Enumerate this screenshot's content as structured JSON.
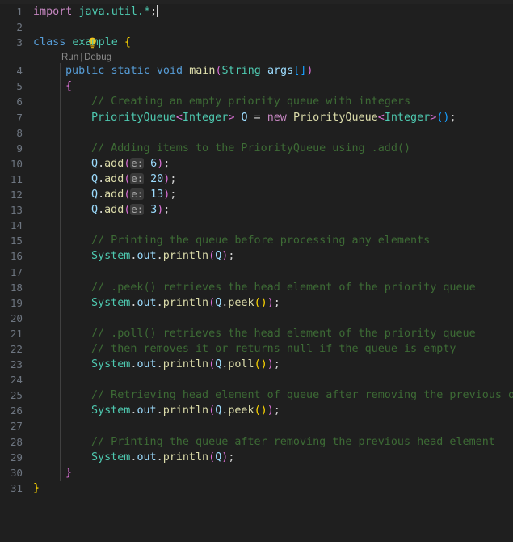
{
  "editor": {
    "language": "java",
    "theme": "dark",
    "background": "#1f1f1f",
    "gutter_color": "#6e7681",
    "comment_color": "#3d6b35",
    "total_lines": 31
  },
  "codelens": {
    "run_label": "Run",
    "separator": "|",
    "debug_label": "Debug"
  },
  "quickfix": {
    "icon": "lightbulb-icon",
    "line": 2
  },
  "lines": [
    {
      "n": "1",
      "text": "import java.util.*;"
    },
    {
      "n": "2",
      "text": ""
    },
    {
      "n": "3",
      "text": "class example {"
    },
    {
      "n": "4",
      "text": "    public static void main(String args[])"
    },
    {
      "n": "5",
      "text": "    {"
    },
    {
      "n": "6",
      "text": "        // Creating an empty priority queue with integers"
    },
    {
      "n": "7",
      "text": "        PriorityQueue<Integer> Q = new PriorityQueue<Integer>();"
    },
    {
      "n": "8",
      "text": ""
    },
    {
      "n": "9",
      "text": "        // Adding items to the PriorityQueue using .add()"
    },
    {
      "n": "10",
      "text": "        Q.add(e: 6);"
    },
    {
      "n": "11",
      "text": "        Q.add(e: 20);"
    },
    {
      "n": "12",
      "text": "        Q.add(e: 13);"
    },
    {
      "n": "13",
      "text": "        Q.add(e: 3);"
    },
    {
      "n": "14",
      "text": ""
    },
    {
      "n": "15",
      "text": "        // Printing the queue before processing any elements"
    },
    {
      "n": "16",
      "text": "        System.out.println(Q);"
    },
    {
      "n": "17",
      "text": ""
    },
    {
      "n": "18",
      "text": "        // .peek() retrieves the head element of the priority queue"
    },
    {
      "n": "19",
      "text": "        System.out.println(Q.peek());"
    },
    {
      "n": "20",
      "text": ""
    },
    {
      "n": "21",
      "text": "        // .poll() retrieves the head element of the priority queue"
    },
    {
      "n": "22",
      "text": "        // then removes it or returns null if the queue is empty"
    },
    {
      "n": "23",
      "text": "        System.out.println(Q.poll());"
    },
    {
      "n": "24",
      "text": ""
    },
    {
      "n": "25",
      "text": "        // Retrieving head element of queue after removing the previous one"
    },
    {
      "n": "26",
      "text": "        System.out.println(Q.peek());"
    },
    {
      "n": "27",
      "text": ""
    },
    {
      "n": "28",
      "text": "        // Printing the queue after removing the previous head element"
    },
    {
      "n": "29",
      "text": "        System.out.println(Q);"
    },
    {
      "n": "30",
      "text": "    }"
    },
    {
      "n": "31",
      "text": "}"
    }
  ],
  "tokens": {
    "import": "import",
    "java_util": "java.util.*",
    "semicolon": ";",
    "class": "class",
    "class_name": "example",
    "public": "public",
    "static": "static",
    "void": "void",
    "main": "main",
    "String": "String",
    "args": "args",
    "PriorityQueue": "PriorityQueue",
    "Integer": "Integer",
    "Q": "Q",
    "new": "new",
    "System": "System",
    "out": "out",
    "println": "println",
    "add": "add",
    "peek": "peek",
    "poll": "poll",
    "param_hint_e": "e:",
    "values": [
      "6",
      "20",
      "13",
      "3"
    ]
  },
  "comments": {
    "c6": "// Creating an empty priority queue with integers",
    "c9": "// Adding items to the PriorityQueue using .add()",
    "c15": "// Printing the queue before processing any elements",
    "c18": "// .peek() retrieves the head element of the priority queue",
    "c21": "// .poll() retrieves the head element of the priority queue",
    "c22": "// then removes it or returns null if the queue is empty",
    "c25": "// Retrieving head element of queue after removing the previous one",
    "c28": "// Printing the queue after removing the previous head element"
  }
}
